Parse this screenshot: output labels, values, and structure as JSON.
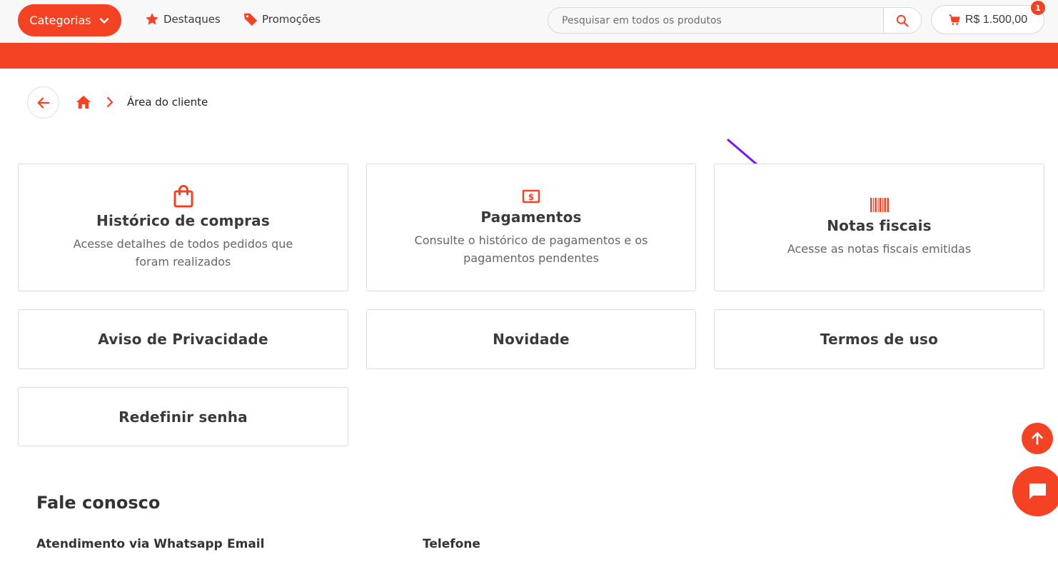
{
  "header": {
    "categories_label": "Categorias",
    "nav": [
      {
        "label": "Destaques",
        "icon": "star-icon"
      },
      {
        "label": "Promoções",
        "icon": "tag-icon"
      }
    ],
    "search": {
      "placeholder": "Pesquisar em todos os produtos",
      "value": ""
    },
    "cart": {
      "total": "R$ 1.500,00",
      "badge_count": "1"
    }
  },
  "breadcrumb": {
    "current": "Área do cliente"
  },
  "cards": [
    {
      "title": "Histórico de compras",
      "description": "Acesse detalhes de todos pedidos que foram realizados",
      "icon": "shopping-bag-icon"
    },
    {
      "title": "Pagamentos",
      "description": "Consulte o histórico de pagamentos e os pagamentos pendentes",
      "icon": "money-icon"
    },
    {
      "title": "Notas fiscais",
      "description": "Acesse as notas fiscais emitidas",
      "icon": "barcode-icon"
    },
    {
      "title": "Aviso de Privacidade"
    },
    {
      "title": "Novidade"
    },
    {
      "title": "Termos de uso"
    },
    {
      "title": "Redefinir senha"
    }
  ],
  "contact": {
    "title": "Fale conosco",
    "labels": [
      "Atendimento via Whatsapp",
      "Email",
      "Telefone"
    ]
  },
  "colors": {
    "accent": "#f44225",
    "annotation_arrow": "#7b16f0"
  }
}
